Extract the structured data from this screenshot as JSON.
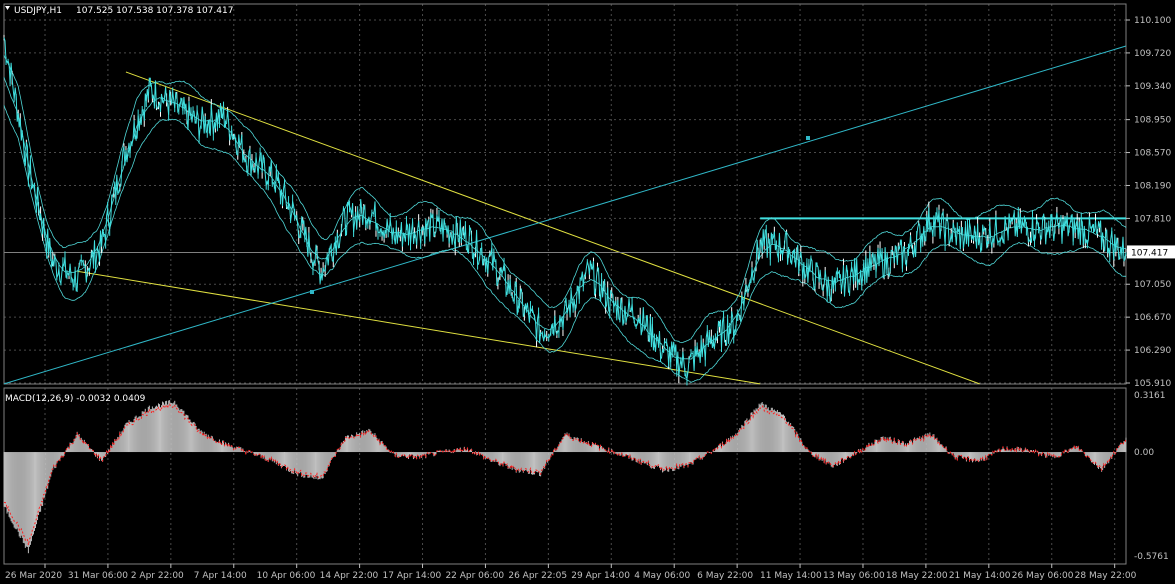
{
  "header": {
    "symbol": "USDJPY,H1",
    "ohlc": "107.525 107.538 107.378 107.417",
    "menu_arrow": "triangle-down-icon"
  },
  "macd_header": {
    "label": "MACD(12,26,9) -0.0032 0.0409"
  },
  "price_axis": {
    "labels": [
      "110.100",
      "109.720",
      "109.340",
      "108.950",
      "108.570",
      "108.190",
      "107.810",
      "107.050",
      "106.670",
      "106.290",
      "105.910"
    ],
    "current_price": "107.417"
  },
  "macd_axis": {
    "labels": [
      "0.3161",
      "0.00",
      "-0.5761"
    ]
  },
  "time_axis": {
    "labels": [
      "26 Mar 2020",
      "31 Mar 06:00",
      "2 Apr 22:00",
      "7 Apr 14:00",
      "10 Apr 06:00",
      "14 Apr 22:00",
      "17 Apr 14:00",
      "22 Apr 06:00",
      "26 Apr 22:05",
      "29 Apr 14:00",
      "4 May 06:00",
      "6 May 22:00",
      "11 May 14:00",
      "13 May 06:00",
      "18 May 22:00",
      "21 May 14:00",
      "26 May 06:00",
      "28 May 22:00"
    ]
  },
  "colors": {
    "background": "#000000",
    "price_line": "#40e0e0",
    "band": "#4fd6d6",
    "trendline": "#e0e040",
    "channel": "#30b8c8",
    "grid": "#4a4a4a",
    "histogram": "#c0c0c0",
    "signal": "#ff2020",
    "axis_text": "#c0c0c0"
  },
  "chart_data": {
    "type": "line",
    "symbol": "USDJPY",
    "timeframe": "H1",
    "price_range": [
      105.91,
      110.1
    ],
    "price_anchor_points": [
      {
        "t": "26 Mar 2020",
        "price": 109.9
      },
      {
        "t": "27 Mar",
        "price": 108.4
      },
      {
        "t": "30 Mar",
        "price": 107.3
      },
      {
        "t": "31 Mar 06:00",
        "price": 107.1
      },
      {
        "t": "1 Apr",
        "price": 107.5
      },
      {
        "t": "2 Apr 22:00",
        "price": 108.6
      },
      {
        "t": "3 Apr",
        "price": 109.3
      },
      {
        "t": "6 Apr",
        "price": 109.1
      },
      {
        "t": "7 Apr 14:00",
        "price": 108.9
      },
      {
        "t": "8 Apr",
        "price": 109.0
      },
      {
        "t": "9 Apr",
        "price": 108.5
      },
      {
        "t": "10 Apr 06:00",
        "price": 108.3
      },
      {
        "t": "13 Apr",
        "price": 107.8
      },
      {
        "t": "14 Apr 22:00",
        "price": 107.2
      },
      {
        "t": "15 Apr",
        "price": 107.8
      },
      {
        "t": "16 Apr",
        "price": 107.9
      },
      {
        "t": "17 Apr 14:00",
        "price": 107.6
      },
      {
        "t": "20 Apr",
        "price": 107.7
      },
      {
        "t": "22 Apr 06:00",
        "price": 107.7
      },
      {
        "t": "23 Apr",
        "price": 107.6
      },
      {
        "t": "26 Apr 22:05",
        "price": 107.3
      },
      {
        "t": "27 Apr",
        "price": 106.9
      },
      {
        "t": "28 Apr",
        "price": 106.5
      },
      {
        "t": "29 Apr 14:00",
        "price": 106.7
      },
      {
        "t": "30 Apr",
        "price": 107.2
      },
      {
        "t": "1 May",
        "price": 106.8
      },
      {
        "t": "4 May 06:00",
        "price": 106.7
      },
      {
        "t": "5 May",
        "price": 106.3
      },
      {
        "t": "6 May 22:00",
        "price": 106.1
      },
      {
        "t": "7 May",
        "price": 106.4
      },
      {
        "t": "8 May",
        "price": 106.6
      },
      {
        "t": "11 May",
        "price": 107.5
      },
      {
        "t": "11 May 14:00",
        "price": 107.5
      },
      {
        "t": "12 May",
        "price": 107.2
      },
      {
        "t": "13 May 06:00",
        "price": 107.0
      },
      {
        "t": "14 May",
        "price": 107.2
      },
      {
        "t": "15 May",
        "price": 107.3
      },
      {
        "t": "18 May 22:00",
        "price": 107.4
      },
      {
        "t": "19 May",
        "price": 107.8
      },
      {
        "t": "20 May",
        "price": 107.6
      },
      {
        "t": "21 May 14:00",
        "price": 107.6
      },
      {
        "t": "22 May",
        "price": 107.7
      },
      {
        "t": "25 May",
        "price": 107.7
      },
      {
        "t": "26 May 06:00",
        "price": 107.7
      },
      {
        "t": "27 May",
        "price": 107.7
      },
      {
        "t": "28 May 22:00",
        "price": 107.6
      },
      {
        "t": "29 May",
        "price": 107.417
      }
    ],
    "horizontal_line": {
      "price": 107.81
    },
    "trendlines": [
      {
        "name": "upper-falling",
        "from": {
          "t": "2 Apr 22:00",
          "price": 109.5
        },
        "to": {
          "t": "21 May 14:00",
          "price": 105.9
        }
      },
      {
        "name": "lower-falling",
        "from": {
          "t": "31 Mar 06:00",
          "price": 107.2
        },
        "to": {
          "t": "11 May",
          "price": 105.9
        }
      },
      {
        "name": "rising-channel",
        "from": {
          "t": "26 Mar 2020",
          "price": 105.9
        },
        "to": {
          "t": "29 May",
          "price": 109.8
        }
      }
    ],
    "macd": {
      "params": "12,26,9",
      "main": -0.0032,
      "signal": 0.0409,
      "range": [
        -0.5761,
        0.3161
      ],
      "histogram": [
        {
          "t": "26 Mar 2020",
          "value": -0.3
        },
        {
          "t": "27 Mar",
          "value": -0.55
        },
        {
          "t": "30 Mar",
          "value": -0.1
        },
        {
          "t": "31 Mar 06:00",
          "value": 0.1
        },
        {
          "t": "1 Apr",
          "value": -0.05
        },
        {
          "t": "2 Apr 22:00",
          "value": 0.15
        },
        {
          "t": "3 Apr",
          "value": 0.25
        },
        {
          "t": "6 Apr",
          "value": 0.28
        },
        {
          "t": "7 Apr 14:00",
          "value": 0.12
        },
        {
          "t": "8 Apr",
          "value": 0.05
        },
        {
          "t": "9 Apr",
          "value": 0.0
        },
        {
          "t": "10 Apr 06:00",
          "value": -0.05
        },
        {
          "t": "13 Apr",
          "value": -0.12
        },
        {
          "t": "14 Apr 22:00",
          "value": -0.15
        },
        {
          "t": "15 Apr",
          "value": 0.08
        },
        {
          "t": "16 Apr",
          "value": 0.12
        },
        {
          "t": "17 Apr 14:00",
          "value": -0.02
        },
        {
          "t": "20 Apr",
          "value": -0.03
        },
        {
          "t": "22 Apr 06:00",
          "value": 0.0
        },
        {
          "t": "23 Apr",
          "value": 0.02
        },
        {
          "t": "26 Apr 22:05",
          "value": -0.05
        },
        {
          "t": "27 Apr",
          "value": -0.1
        },
        {
          "t": "28 Apr",
          "value": -0.12
        },
        {
          "t": "29 Apr 14:00",
          "value": 0.1
        },
        {
          "t": "30 Apr",
          "value": 0.05
        },
        {
          "t": "1 May",
          "value": 0.0
        },
        {
          "t": "4 May 06:00",
          "value": -0.05
        },
        {
          "t": "5 May",
          "value": -0.1
        },
        {
          "t": "6 May 22:00",
          "value": -0.08
        },
        {
          "t": "7 May",
          "value": 0.0
        },
        {
          "t": "8 May",
          "value": 0.1
        },
        {
          "t": "11 May",
          "value": 0.27
        },
        {
          "t": "11 May 14:00",
          "value": 0.2
        },
        {
          "t": "12 May",
          "value": 0.0
        },
        {
          "t": "13 May 06:00",
          "value": -0.08
        },
        {
          "t": "14 May",
          "value": 0.0
        },
        {
          "t": "15 May",
          "value": 0.08
        },
        {
          "t": "18 May 22:00",
          "value": 0.05
        },
        {
          "t": "19 May",
          "value": 0.1
        },
        {
          "t": "20 May",
          "value": -0.03
        },
        {
          "t": "21 May 14:00",
          "value": -0.05
        },
        {
          "t": "22 May",
          "value": 0.02
        },
        {
          "t": "25 May",
          "value": 0.01
        },
        {
          "t": "26 May 06:00",
          "value": -0.03
        },
        {
          "t": "27 May",
          "value": 0.03
        },
        {
          "t": "28 May 22:00",
          "value": -0.1
        },
        {
          "t": "29 May",
          "value": 0.08
        }
      ]
    }
  }
}
